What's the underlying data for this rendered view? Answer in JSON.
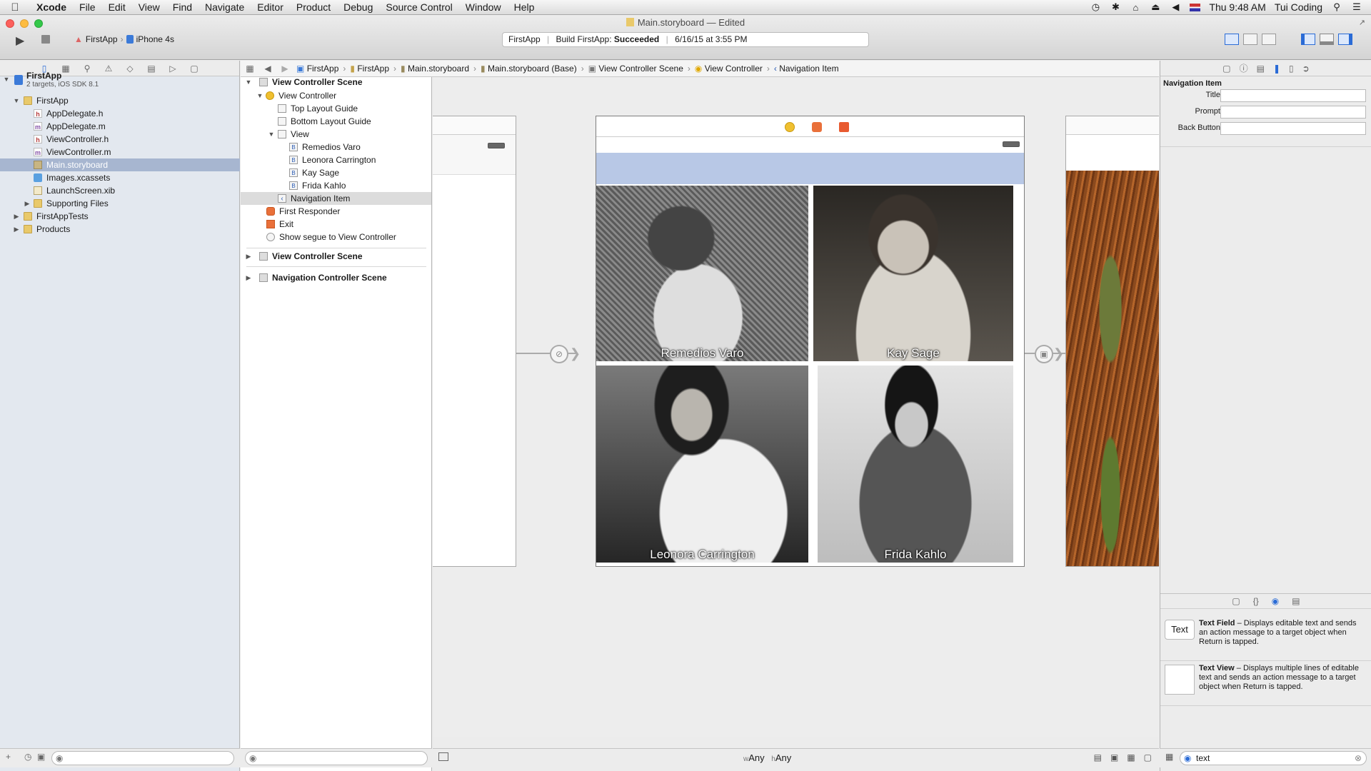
{
  "menubar": {
    "app": "Xcode",
    "items": [
      "File",
      "Edit",
      "View",
      "Find",
      "Navigate",
      "Editor",
      "Product",
      "Debug",
      "Source Control",
      "Window",
      "Help"
    ],
    "clock": "Thu 9:48 AM",
    "user": "Tui Coding"
  },
  "window": {
    "title": "Main.storyboard — Edited",
    "scheme": "FirstApp",
    "device": "iPhone 4s",
    "activity": {
      "project": "FirstApp",
      "status_prefix": "Build FirstApp:",
      "status": "Succeeded",
      "timestamp": "6/16/15 at 3:55 PM"
    }
  },
  "navigator": {
    "project": {
      "name": "FirstApp",
      "subtitle": "2 targets, iOS SDK 8.1"
    },
    "group": "FirstApp",
    "files": [
      {
        "name": "AppDelegate.h",
        "badge": "h"
      },
      {
        "name": "AppDelegate.m",
        "badge": "m"
      },
      {
        "name": "ViewController.h",
        "badge": "h"
      },
      {
        "name": "ViewController.m",
        "badge": "m"
      },
      {
        "name": "Main.storyboard",
        "badge": ""
      },
      {
        "name": "Images.xcassets",
        "badge": ""
      },
      {
        "name": "LaunchScreen.xib",
        "badge": ""
      }
    ],
    "supporting": "Supporting Files",
    "tests": "FirstAppTests",
    "products": "Products"
  },
  "outline": {
    "scene1": "View Controller Scene",
    "view_controller": "View Controller",
    "top_guide": "Top Layout Guide",
    "bottom_guide": "Bottom Layout Guide",
    "view": "View",
    "buttons": [
      "Remedios Varo",
      "Leonora Carrington",
      "Kay Sage",
      "Frida Kahlo"
    ],
    "button_badge": "B",
    "nav_item": "Navigation Item",
    "first_responder": "First Responder",
    "exit": "Exit",
    "segue": "Show segue to View Controller",
    "scene2": "View Controller Scene",
    "scene3": "Navigation Controller Scene"
  },
  "jumpbar": [
    "FirstApp",
    "FirstApp",
    "Main.storyboard",
    "Main.storyboard (Base)",
    "View Controller Scene",
    "View Controller",
    "Navigation Item"
  ],
  "canvas": {
    "captions": [
      "Remedios Varo",
      "Kay Sage",
      "Leonora Carrington",
      "Frida Kahlo"
    ],
    "size_class": {
      "w_prefix": "w",
      "w": "Any",
      "h_prefix": "h",
      "h": "Any"
    }
  },
  "inspector": {
    "heading": "Navigation Item",
    "fields": [
      {
        "label": "Title",
        "value": ""
      },
      {
        "label": "Prompt",
        "value": ""
      },
      {
        "label": "Back Button",
        "value": ""
      }
    ]
  },
  "library": {
    "items": [
      {
        "icon_text": "Text",
        "name": "Text Field",
        "desc": " – Displays editable text and sends an action message to a target object when Return is tapped."
      },
      {
        "icon_text": "",
        "name": "Text View",
        "desc": " – Displays multiple lines of editable text and sends an action message to a target object when Return is tapped."
      }
    ],
    "filter": "text"
  },
  "colors": {
    "accent": "#2a6bd6",
    "nav_bar": "#b8c8e6",
    "selection": "#a7b6d0"
  }
}
